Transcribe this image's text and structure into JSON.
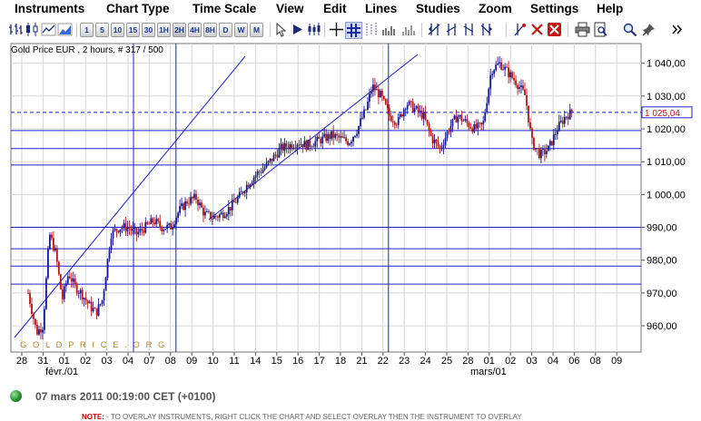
{
  "menu": {
    "items": [
      "Instruments",
      "Chart Type",
      "Time Scale",
      "View",
      "Edit",
      "Lines",
      "Studies",
      "Zoom",
      "Settings",
      "Help"
    ]
  },
  "toolbar": {
    "timeframes": [
      "1",
      "5",
      "10",
      "15",
      "30",
      "1H",
      "2H",
      "4H",
      "8H",
      "D",
      "W",
      "M"
    ]
  },
  "chart": {
    "title": "Gold Price EUR , 2 hours, # 317 / 500",
    "watermark": "G O L D P R I C E . O R G",
    "price_axis": {
      "ticks": [
        "1 040,00",
        "1 030,00",
        "1 020,00",
        "1 010,00",
        "1 000,00",
        "990,00",
        "980,00",
        "970,00",
        "960,00"
      ],
      "current_label": "1 025,04"
    },
    "date_axis": {
      "ticks": [
        "28",
        "31",
        "01",
        "02",
        "03",
        "04",
        "07",
        "08",
        "09",
        "10",
        "11",
        "14",
        "15",
        "16",
        "17",
        "18",
        "21",
        "22",
        "23",
        "24",
        "25",
        "28",
        "01",
        "02",
        "03",
        "04",
        "06",
        "08",
        "09"
      ],
      "months": [
        "févr./01",
        "mars/01"
      ]
    },
    "colors": {
      "bull": "#1a1a8c",
      "bear": "#b01818",
      "lines": "#2020c8",
      "grid": "#d6d6d6"
    }
  },
  "chart_data": {
    "type": "candlestick",
    "title": "Gold Price EUR , 2 hours, # 317 / 500",
    "ylim": [
      952,
      1046
    ],
    "x_categories": [
      "28",
      "31",
      "01",
      "02",
      "03",
      "04",
      "07",
      "08",
      "09",
      "10",
      "11",
      "14",
      "15",
      "16",
      "17",
      "18",
      "21",
      "22",
      "23",
      "24",
      "25",
      "28",
      "01",
      "02",
      "03",
      "04",
      "06",
      "08",
      "09"
    ],
    "current_price": 1025.04,
    "horizontal_levels": [
      1019.5,
      1014.0,
      1009.0,
      990.0,
      983.5,
      978.2,
      972.7
    ],
    "vertical_line_dates": [
      "04",
      "08",
      "22"
    ],
    "path_points": [
      [
        0.3,
        970
      ],
      [
        0.7,
        958
      ],
      [
        1.0,
        960
      ],
      [
        1.3,
        988
      ],
      [
        1.6,
        982
      ],
      [
        1.9,
        968
      ],
      [
        2.2,
        976
      ],
      [
        2.5,
        972
      ],
      [
        2.8,
        970
      ],
      [
        3.2,
        966
      ],
      [
        3.5,
        964
      ],
      [
        3.8,
        968
      ],
      [
        4.2,
        988
      ],
      [
        4.6,
        990
      ],
      [
        5.0,
        990
      ],
      [
        5.4,
        988
      ],
      [
        5.8,
        990
      ],
      [
        6.2,
        992
      ],
      [
        6.6,
        990
      ],
      [
        7.0,
        990
      ],
      [
        7.4,
        995
      ],
      [
        7.8,
        998
      ],
      [
        8.2,
        999
      ],
      [
        8.6,
        994
      ],
      [
        9.0,
        993
      ],
      [
        9.4,
        994
      ],
      [
        9.8,
        996
      ],
      [
        10.2,
        999
      ],
      [
        10.6,
        1003
      ],
      [
        11.0,
        1006
      ],
      [
        11.4,
        1008
      ],
      [
        11.8,
        1011
      ],
      [
        12.2,
        1014
      ],
      [
        12.6,
        1015
      ],
      [
        13.0,
        1016
      ],
      [
        13.4,
        1015
      ],
      [
        13.8,
        1016
      ],
      [
        14.2,
        1017
      ],
      [
        14.6,
        1018
      ],
      [
        15.0,
        1017
      ],
      [
        15.4,
        1016
      ],
      [
        15.8,
        1020
      ],
      [
        16.2,
        1026
      ],
      [
        16.5,
        1033
      ],
      [
        16.9,
        1030
      ],
      [
        17.3,
        1024
      ],
      [
        17.7,
        1022
      ],
      [
        18.1,
        1028
      ],
      [
        18.5,
        1026
      ],
      [
        18.9,
        1024
      ],
      [
        19.3,
        1017
      ],
      [
        19.7,
        1014
      ],
      [
        20.1,
        1020
      ],
      [
        20.5,
        1024
      ],
      [
        20.9,
        1022
      ],
      [
        21.3,
        1020
      ],
      [
        21.7,
        1021
      ],
      [
        22.1,
        1038
      ],
      [
        22.5,
        1040
      ],
      [
        22.9,
        1037
      ],
      [
        23.3,
        1034
      ],
      [
        23.7,
        1030
      ],
      [
        24.0,
        1016
      ],
      [
        24.4,
        1012
      ],
      [
        24.8,
        1014
      ],
      [
        25.2,
        1020
      ],
      [
        25.6,
        1024
      ],
      [
        25.9,
        1025
      ]
    ]
  },
  "status": {
    "datetime": "07 mars 2011 00:19:00  CET (+0100)"
  },
  "note": {
    "label": "NOTE:",
    "text": " - TO OVERLAY INSTRUMENTS, RIGHT CLICK THE CHART AND SELECT OVERLAY THEN THE INSTRUMENT TO OVERLAY"
  }
}
